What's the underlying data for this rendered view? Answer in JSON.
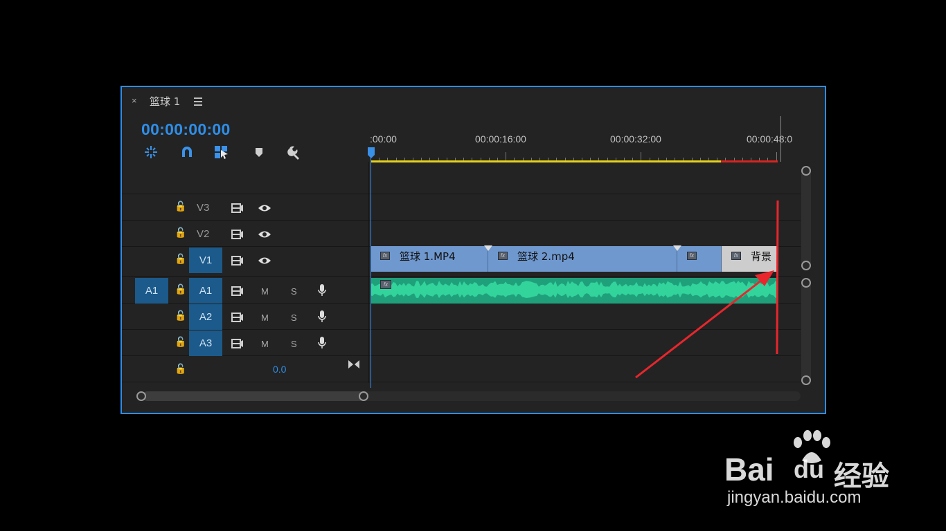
{
  "sequence": {
    "close_label": "×",
    "title": "篮球 1",
    "timecode": "00:00:00:00"
  },
  "ruler": {
    "labels": [
      ":00:00",
      "00:00:16:00",
      "00:00:32:00",
      "00:00:48:0"
    ]
  },
  "tracks": {
    "video": [
      {
        "label": "V3",
        "targeted": false
      },
      {
        "label": "V2",
        "targeted": false
      },
      {
        "label": "V1",
        "targeted": true
      }
    ],
    "audio": [
      {
        "source": "A1",
        "label": "A1",
        "mute": "M",
        "solo": "S"
      },
      {
        "label": "A2",
        "mute": "M",
        "solo": "S"
      },
      {
        "label": "A3",
        "mute": "M",
        "solo": "S"
      }
    ],
    "master_value": "0.0"
  },
  "clips": {
    "v1": [
      {
        "name": "篮球 1.MP4"
      },
      {
        "name": "篮球 2.mp4"
      },
      {
        "name": ""
      },
      {
        "name": "背景"
      }
    ],
    "fx_label": "fx"
  },
  "colors": {
    "accent": "#2d8ceb",
    "video_clip": "#6f98cf",
    "audio_clip": "#1fa07a",
    "annotation": "#e8262c"
  },
  "watermark": {
    "brand": "Bai",
    "brand2": "du",
    "brand3": "经验",
    "url": "jingyan.baidu.com"
  }
}
